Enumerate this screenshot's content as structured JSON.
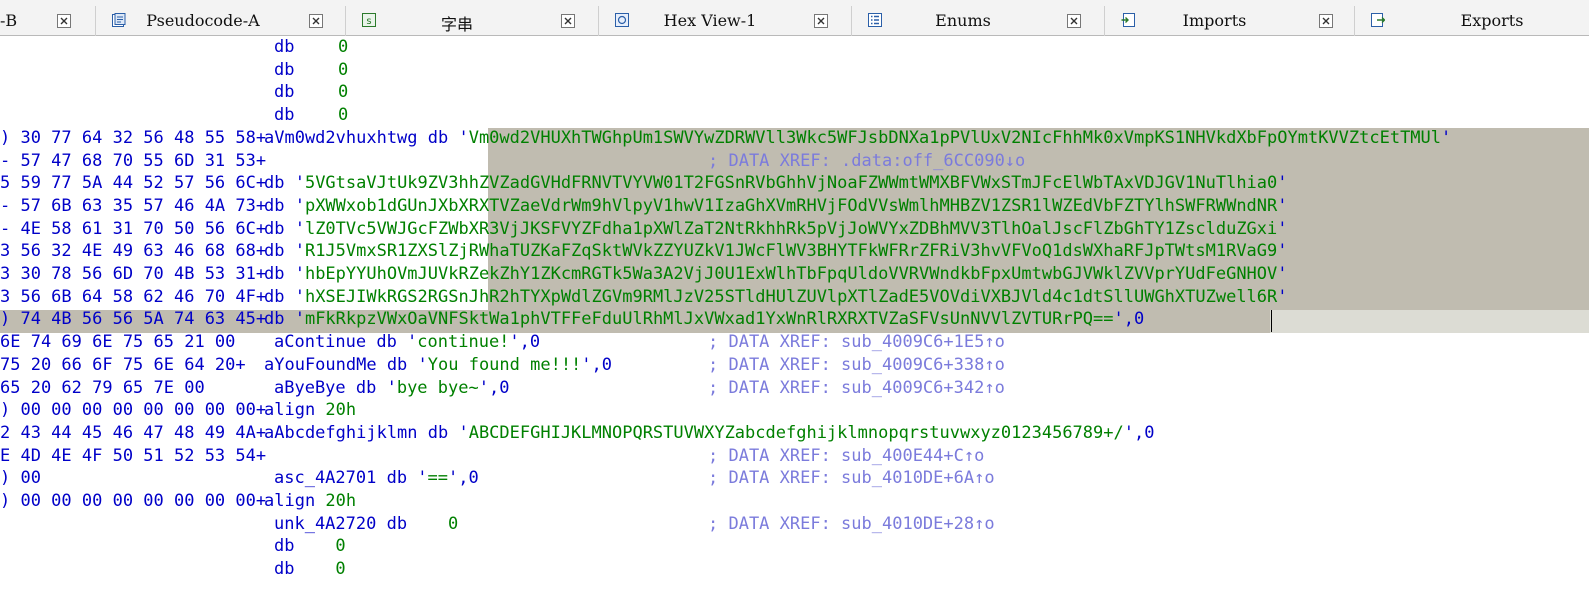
{
  "tabs": [
    {
      "label": "-B",
      "icon": "none"
    },
    {
      "label": "Pseudocode-A",
      "icon": "pseudocode-icon"
    },
    {
      "label": "字串",
      "icon": "strings-icon"
    },
    {
      "label": "Hex View-1",
      "icon": "hex-view-icon"
    },
    {
      "label": "Enums",
      "icon": "enums-icon"
    },
    {
      "label": "Imports",
      "icon": "imports-icon"
    },
    {
      "label": "Exports",
      "icon": "exports-icon"
    }
  ],
  "colors": {
    "bytes": "#0000c8",
    "string": "#008000",
    "comment": "#7b7bdc",
    "selection": "#c0bcb0"
  },
  "listing": {
    "rows": [
      {
        "bytes": "",
        "name": "",
        "op": "db",
        "value": "0",
        "comment": ""
      },
      {
        "bytes": "",
        "name": "",
        "op": "db",
        "value": "0",
        "comment": ""
      },
      {
        "bytes": "",
        "name": "",
        "op": "db",
        "value": "0",
        "comment": ""
      },
      {
        "bytes": "",
        "name": "",
        "op": "db",
        "value": "0",
        "comment": ""
      },
      {
        "bytes": ") 30 77 64 32 56 48 55 58+",
        "name": "aVm0wd2vhuxhtwg db '",
        "str": "Vm0wd2VHUXhTWGhpUm1SWVYwZDRWVll3Wkc5WFJsbDNXa1pPVlUxV2NIcFhhMk0xVmpKS1NHVkdXbFpOYmtKVVZtcEtTMUl",
        "tail": "'",
        "comment": ""
      },
      {
        "bytes": "- 57 47 68 70 55 6D 31 53+",
        "name": "",
        "str": "",
        "tail": "",
        "comment": "; DATA XREF: .data:off_6CC090↓o"
      },
      {
        "bytes": "5 59 77 5A 44 52 57 56 6C+",
        "name": "db '",
        "str": "5VGtsaVJtUk9ZV3hhZVZadGVHdFRNVTVYVW01T2FGSnRVbGhhVjNoaFZWWmtWMXBFVWxSTmJFcElWbTAxVDJGV1NuTlhia0",
        "tail": "'",
        "comment": ""
      },
      {
        "bytes": "- 57 6B 63 35 57 46 4A 73+",
        "name": "db '",
        "str": "pXWWxob1dGUnJXbXRXTVZaeVdrWm9hVlpyV1hwV1IzaGhXVmRHVjFOdVVsWmlhMHBZV1ZSR1lWZEdVbFZTYlhSWFRWWndNR",
        "tail": "'",
        "comment": ""
      },
      {
        "bytes": "- 4E 58 61 31 70 50 56 6C+",
        "name": "db '",
        "str": "lZ0TVc5VWJGcFZWbXR3VjJKSFVYZFdha1pXWlZaT2NtRkhhRk5pVjJoWVYxZDBhMVV3TlhOalJscFlZbGhTY1ZsclduZGxi",
        "tail": "'",
        "comment": ""
      },
      {
        "bytes": "3 56 32 4E 49 63 46 68 68+",
        "name": "db '",
        "str": "R1J5VmxSR1ZXSlZjRWhaTUZKaFZqSktWVkZZYUZkV1JWcFlWV3BHYTFkWFRrZFRiV3hvVFVoQ1dsWXhaRFJpTWtsM1RVaG9",
        "tail": "'",
        "comment": ""
      },
      {
        "bytes": "3 30 78 56 6D 70 4B 53 31+",
        "name": "db '",
        "str": "hbEpYYUhOVmJUVkRZekZhY1ZKcmRGTk5Wa3A2VjJ0U1ExWlhTbFpqUldoVVRVWndkbFpxUmtwbGJVWklZVVprYUdFeGNHOV",
        "tail": "'",
        "comment": ""
      },
      {
        "bytes": "3 56 6B 64 58 62 46 70 4F+",
        "name": "db '",
        "str": "hXSEJIWkRGS2RGSnJhR2hTYXpWdlZGVm9RMlJzV25STldHUlZUVlpXTlZadE5VOVdiVXBJVld4c1dtSllUWGhXTUZwell6R",
        "tail": "'",
        "comment": ""
      },
      {
        "bytes": ") 74 4B 56 56 5A 74 63 45+",
        "name": "db '",
        "str": "mFkRkpzVWxOaVNFSktWa1phVTFFeFduUlRhMlJxVWxad1YxWnRlRXRXTVZaSFVsUnNVVlZVTURrPQ==",
        "tail": "',0",
        "comment": ""
      },
      {
        "bytes": "6E 74 69 6E 75 65 21 00",
        "name": "aContinue db '",
        "str": "continue!",
        "tail": "',0",
        "comment": "; DATA XREF: sub_4009C6+1E5↑o"
      },
      {
        "bytes": "75 20 66 6F 75 6E 64 20+",
        "name": "aYouFoundMe db '",
        "str": "You found me!!!",
        "tail": "',0",
        "comment": "; DATA XREF: sub_4009C6+338↑o"
      },
      {
        "bytes": "65 20 62 79 65 7E 00",
        "name": "aByeBye db '",
        "str": "bye bye~",
        "tail": "',0",
        "comment": "; DATA XREF: sub_4009C6+342↑o"
      },
      {
        "bytes": ") 00 00 00 00 00 00 00 00+",
        "name": "align ",
        "str": "20h",
        "tail": "",
        "comment": ""
      },
      {
        "bytes": "2 43 44 45 46 47 48 49 4A+",
        "name": "aAbcdefghijklmn db '",
        "str": "ABCDEFGHIJKLMNOPQRSTUVWXYZabcdefghijklmnopqrstuvwxyz0123456789+/",
        "tail": "',0",
        "comment": ""
      },
      {
        "bytes": "E 4D 4E 4F 50 51 52 53 54+",
        "name": "",
        "str": "",
        "tail": "",
        "comment": "; DATA XREF: sub_400E44+C↑o"
      },
      {
        "bytes": ") 00",
        "name": "asc_4A2701 db '",
        "str": "==",
        "tail": "',0",
        "comment": "; DATA XREF: sub_4010DE+6A↑o"
      },
      {
        "bytes": ") 00 00 00 00 00 00 00 00+",
        "name": "align ",
        "str": "20h",
        "tail": "",
        "comment": ""
      },
      {
        "bytes": "",
        "name": "unk_4A2720 db    ",
        "str": "0",
        "tail": "",
        "comment": "; DATA XREF: sub_4010DE+28↑o"
      },
      {
        "bytes": "",
        "name": "db    ",
        "str": "0",
        "tail": "",
        "comment": ""
      },
      {
        "bytes": "",
        "name": "db    ",
        "str": "0",
        "tail": "",
        "comment": ""
      }
    ]
  }
}
